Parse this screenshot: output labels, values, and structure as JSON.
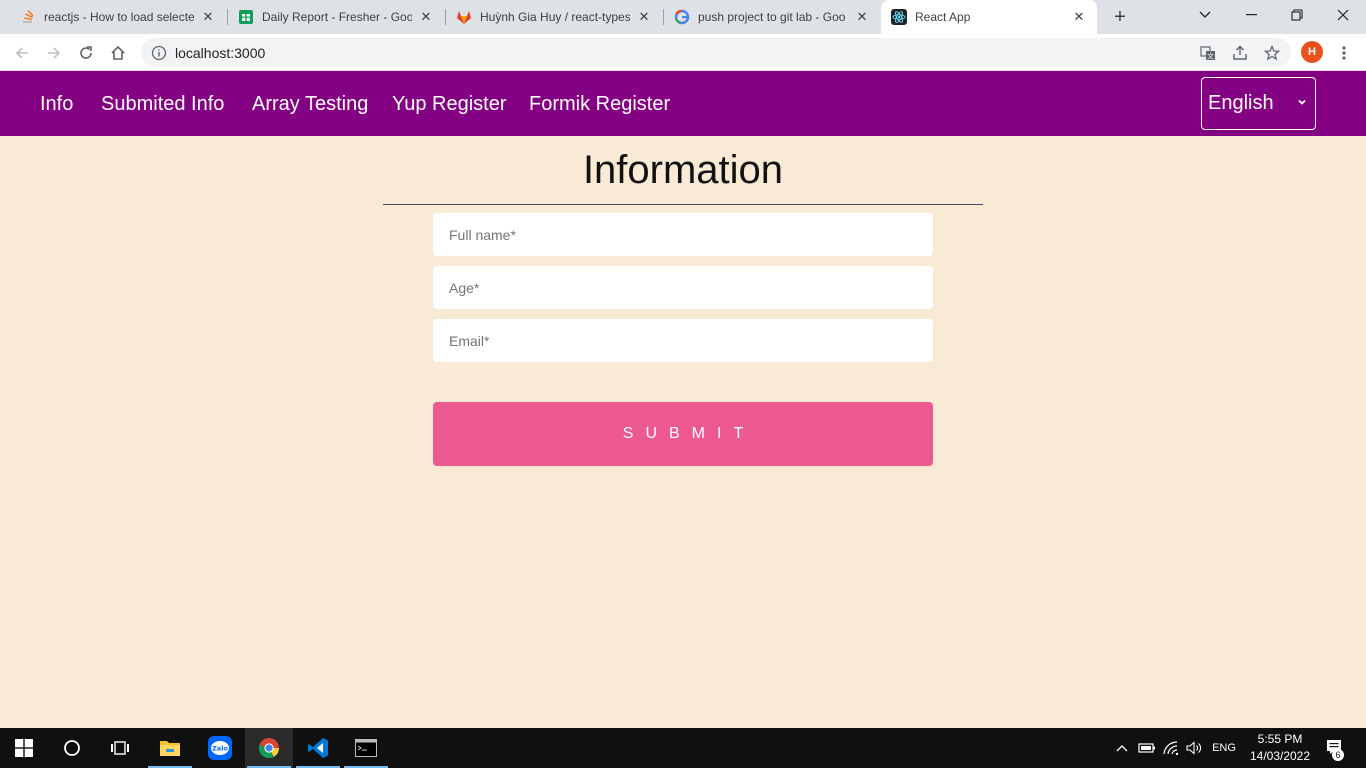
{
  "browser": {
    "tabs": [
      {
        "label": "reactjs - How to load selected",
        "icon": "stackoverflow-icon"
      },
      {
        "label": "Daily Report - Fresher - Goog",
        "icon": "google-sheets-icon"
      },
      {
        "label": "Huỳnh Gia Huy / react-types",
        "icon": "gitlab-icon"
      },
      {
        "label": "push project to git lab - Goo",
        "icon": "google-icon"
      },
      {
        "label": "React App",
        "icon": "react-icon",
        "active": true
      }
    ],
    "url": "localhost:3000",
    "profile_initial": "H"
  },
  "nav": {
    "links": [
      "Info",
      "Submited Info",
      "Array Testing",
      "Yup Register",
      "Formik Register"
    ],
    "language": "English"
  },
  "form": {
    "title": "Information",
    "fullname_placeholder": "Full name*",
    "age_placeholder": "Age*",
    "email_placeholder": "Email*",
    "submit_label": "SUBMIT"
  },
  "taskbar": {
    "language": "ENG",
    "time": "5:55 PM",
    "date": "14/03/2022",
    "notification_count": "6"
  },
  "colors": {
    "nav_bg": "#830082",
    "page_bg": "#f9ead6",
    "submit_bg": "#ec5990"
  }
}
